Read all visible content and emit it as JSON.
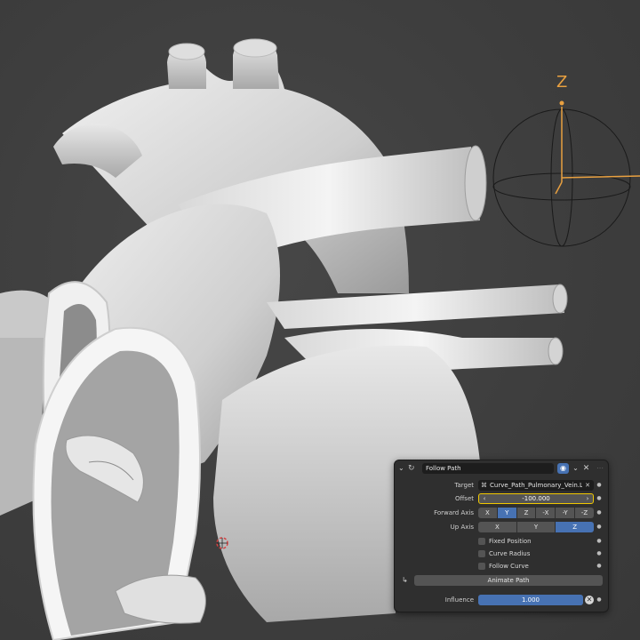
{
  "viewport": {
    "gizmo": {
      "axis_label": "Z"
    }
  },
  "constraint": {
    "name": "Follow Path",
    "fields": {
      "target_label": "Target",
      "target_value": "Curve_Path_Pulmonary_Vein.L",
      "offset_label": "Offset",
      "offset_value": "-100.000",
      "forward_axis_label": "Forward Axis",
      "forward_axis_options": [
        "X",
        "Y",
        "Z",
        "-X",
        "-Y",
        "-Z"
      ],
      "forward_axis_selected": "Y",
      "up_axis_label": "Up Axis",
      "up_axis_options": [
        "X",
        "Y",
        "Z"
      ],
      "up_axis_selected": "Z"
    },
    "checkboxes": [
      {
        "label": "Fixed Position",
        "checked": false
      },
      {
        "label": "Curve Radius",
        "checked": false
      },
      {
        "label": "Follow Curve",
        "checked": false
      }
    ],
    "animate_path_label": "Animate Path",
    "influence_label": "Influence",
    "influence_value": "1.000",
    "influence_fraction": 1.0
  },
  "colors": {
    "accent_blue": "#4772b3",
    "highlight_yellow": "#f0c800",
    "gizmo_orange": "#e8a040",
    "panel_bg": "#2f2f2f"
  }
}
